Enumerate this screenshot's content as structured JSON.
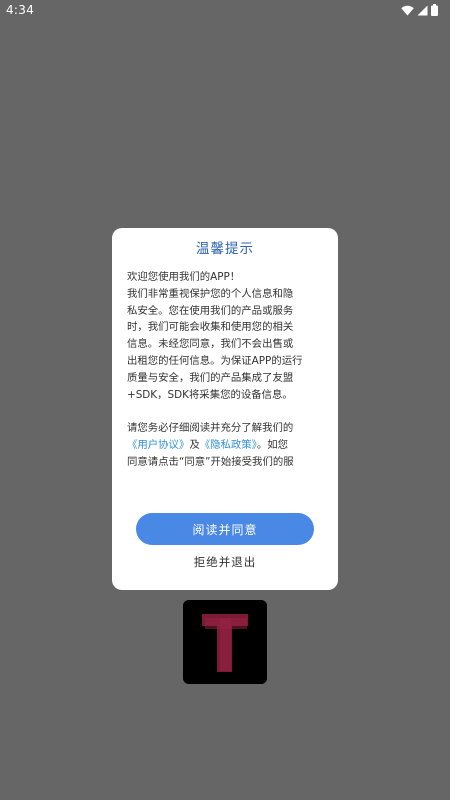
{
  "status_bar": {
    "time": "4:34"
  },
  "dialog": {
    "title": "温馨提示",
    "lines": [
      "欢迎您使用我们的APP！",
      "我们非常重视保护您的个人信息和隐",
      "私安全。您在使用我们的产品或服务",
      "时，我们可能会收集和使用您的相关",
      "信息。未经您同意，我们不会出售或",
      "出租您的任何信息。为保证APP的运行",
      "质量与安全，我们的产品集成了友盟",
      "+SDK，SDK将采集您的设备信息。"
    ],
    "notice_line1": "请您务必仔细阅读并充分了解我们的",
    "user_agreement_link": "《用户协议》",
    "and_text": "及",
    "privacy_policy_link": "《隐私政策》",
    "notice_line2_tail": "。如您",
    "notice_line3": "同意请点击“同意”开始接受我们的服",
    "agree_button": "阅读并同意",
    "reject_button": "拒绝并退出"
  },
  "colors": {
    "background": "#666666",
    "title": "#2b63b0",
    "link": "#2f8fd8",
    "button": "#4a88e6"
  },
  "icons": [
    "wifi-icon",
    "signal-icon",
    "battery-icon",
    "app-logo-icon"
  ]
}
